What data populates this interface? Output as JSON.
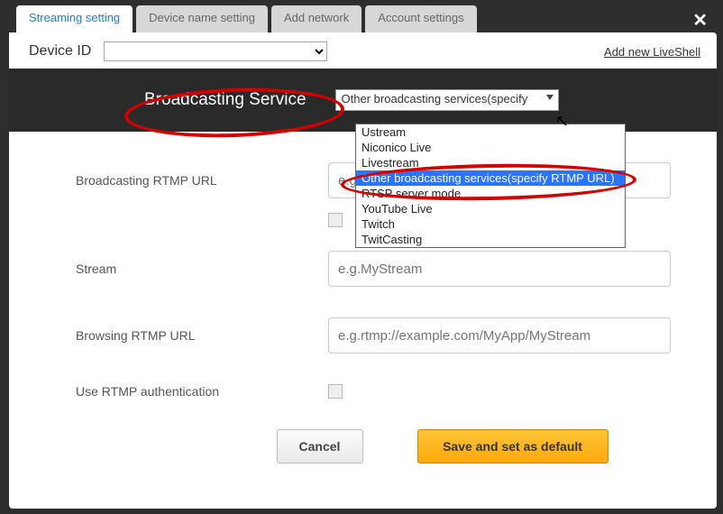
{
  "tabs": {
    "streaming": "Streaming setting",
    "devicename": "Device name setting",
    "addnetwork": "Add network",
    "account": "Account settings"
  },
  "close_glyph": "✕",
  "device": {
    "label": "Device ID",
    "value": "",
    "addnew": "Add new LiveShell"
  },
  "broadcast": {
    "label": "Broadcasting Service",
    "selected": "Other broadcasting services(specify",
    "options": [
      "Ustream",
      "Niconico Live",
      "Livestream",
      "Other broadcasting services(specify RTMP URL)",
      "RTSP server mode",
      "YouTube Live",
      "Twitch",
      "TwitCasting"
    ],
    "highlight_index": 3
  },
  "form": {
    "rtmp_url_label": "Broadcasting RTMP URL",
    "rtmp_url_placeholder": "e.g",
    "stream_label": "Stream",
    "stream_placeholder": "e.g.MyStream",
    "browse_label": "Browsing RTMP URL",
    "browse_placeholder": "e.g.rtmp://example.com/MyApp/MyStream",
    "auth_label": "Use RTMP authentication"
  },
  "buttons": {
    "cancel": "Cancel",
    "save": "Save and set as default"
  },
  "cursor_glyph": "↖"
}
